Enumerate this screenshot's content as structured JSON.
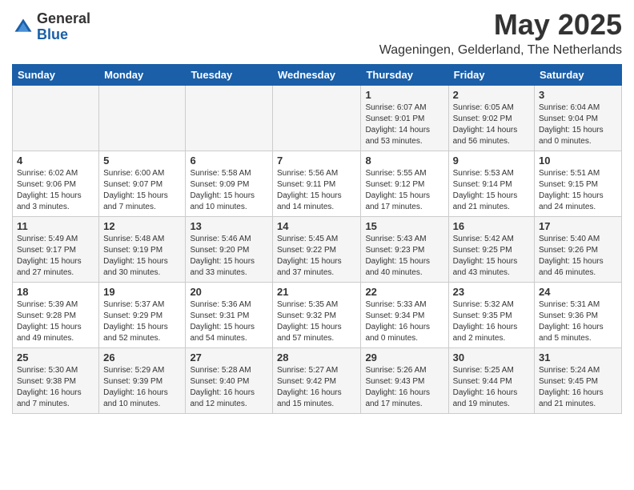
{
  "header": {
    "logo_general": "General",
    "logo_blue": "Blue",
    "month": "May 2025",
    "location": "Wageningen, Gelderland, The Netherlands"
  },
  "days_of_week": [
    "Sunday",
    "Monday",
    "Tuesday",
    "Wednesday",
    "Thursday",
    "Friday",
    "Saturday"
  ],
  "weeks": [
    [
      {
        "day": "",
        "info": ""
      },
      {
        "day": "",
        "info": ""
      },
      {
        "day": "",
        "info": ""
      },
      {
        "day": "",
        "info": ""
      },
      {
        "day": "1",
        "info": "Sunrise: 6:07 AM\nSunset: 9:01 PM\nDaylight: 14 hours\nand 53 minutes."
      },
      {
        "day": "2",
        "info": "Sunrise: 6:05 AM\nSunset: 9:02 PM\nDaylight: 14 hours\nand 56 minutes."
      },
      {
        "day": "3",
        "info": "Sunrise: 6:04 AM\nSunset: 9:04 PM\nDaylight: 15 hours\nand 0 minutes."
      }
    ],
    [
      {
        "day": "4",
        "info": "Sunrise: 6:02 AM\nSunset: 9:06 PM\nDaylight: 15 hours\nand 3 minutes."
      },
      {
        "day": "5",
        "info": "Sunrise: 6:00 AM\nSunset: 9:07 PM\nDaylight: 15 hours\nand 7 minutes."
      },
      {
        "day": "6",
        "info": "Sunrise: 5:58 AM\nSunset: 9:09 PM\nDaylight: 15 hours\nand 10 minutes."
      },
      {
        "day": "7",
        "info": "Sunrise: 5:56 AM\nSunset: 9:11 PM\nDaylight: 15 hours\nand 14 minutes."
      },
      {
        "day": "8",
        "info": "Sunrise: 5:55 AM\nSunset: 9:12 PM\nDaylight: 15 hours\nand 17 minutes."
      },
      {
        "day": "9",
        "info": "Sunrise: 5:53 AM\nSunset: 9:14 PM\nDaylight: 15 hours\nand 21 minutes."
      },
      {
        "day": "10",
        "info": "Sunrise: 5:51 AM\nSunset: 9:15 PM\nDaylight: 15 hours\nand 24 minutes."
      }
    ],
    [
      {
        "day": "11",
        "info": "Sunrise: 5:49 AM\nSunset: 9:17 PM\nDaylight: 15 hours\nand 27 minutes."
      },
      {
        "day": "12",
        "info": "Sunrise: 5:48 AM\nSunset: 9:19 PM\nDaylight: 15 hours\nand 30 minutes."
      },
      {
        "day": "13",
        "info": "Sunrise: 5:46 AM\nSunset: 9:20 PM\nDaylight: 15 hours\nand 33 minutes."
      },
      {
        "day": "14",
        "info": "Sunrise: 5:45 AM\nSunset: 9:22 PM\nDaylight: 15 hours\nand 37 minutes."
      },
      {
        "day": "15",
        "info": "Sunrise: 5:43 AM\nSunset: 9:23 PM\nDaylight: 15 hours\nand 40 minutes."
      },
      {
        "day": "16",
        "info": "Sunrise: 5:42 AM\nSunset: 9:25 PM\nDaylight: 15 hours\nand 43 minutes."
      },
      {
        "day": "17",
        "info": "Sunrise: 5:40 AM\nSunset: 9:26 PM\nDaylight: 15 hours\nand 46 minutes."
      }
    ],
    [
      {
        "day": "18",
        "info": "Sunrise: 5:39 AM\nSunset: 9:28 PM\nDaylight: 15 hours\nand 49 minutes."
      },
      {
        "day": "19",
        "info": "Sunrise: 5:37 AM\nSunset: 9:29 PM\nDaylight: 15 hours\nand 52 minutes."
      },
      {
        "day": "20",
        "info": "Sunrise: 5:36 AM\nSunset: 9:31 PM\nDaylight: 15 hours\nand 54 minutes."
      },
      {
        "day": "21",
        "info": "Sunrise: 5:35 AM\nSunset: 9:32 PM\nDaylight: 15 hours\nand 57 minutes."
      },
      {
        "day": "22",
        "info": "Sunrise: 5:33 AM\nSunset: 9:34 PM\nDaylight: 16 hours\nand 0 minutes."
      },
      {
        "day": "23",
        "info": "Sunrise: 5:32 AM\nSunset: 9:35 PM\nDaylight: 16 hours\nand 2 minutes."
      },
      {
        "day": "24",
        "info": "Sunrise: 5:31 AM\nSunset: 9:36 PM\nDaylight: 16 hours\nand 5 minutes."
      }
    ],
    [
      {
        "day": "25",
        "info": "Sunrise: 5:30 AM\nSunset: 9:38 PM\nDaylight: 16 hours\nand 7 minutes."
      },
      {
        "day": "26",
        "info": "Sunrise: 5:29 AM\nSunset: 9:39 PM\nDaylight: 16 hours\nand 10 minutes."
      },
      {
        "day": "27",
        "info": "Sunrise: 5:28 AM\nSunset: 9:40 PM\nDaylight: 16 hours\nand 12 minutes."
      },
      {
        "day": "28",
        "info": "Sunrise: 5:27 AM\nSunset: 9:42 PM\nDaylight: 16 hours\nand 15 minutes."
      },
      {
        "day": "29",
        "info": "Sunrise: 5:26 AM\nSunset: 9:43 PM\nDaylight: 16 hours\nand 17 minutes."
      },
      {
        "day": "30",
        "info": "Sunrise: 5:25 AM\nSunset: 9:44 PM\nDaylight: 16 hours\nand 19 minutes."
      },
      {
        "day": "31",
        "info": "Sunrise: 5:24 AM\nSunset: 9:45 PM\nDaylight: 16 hours\nand 21 minutes."
      }
    ]
  ]
}
